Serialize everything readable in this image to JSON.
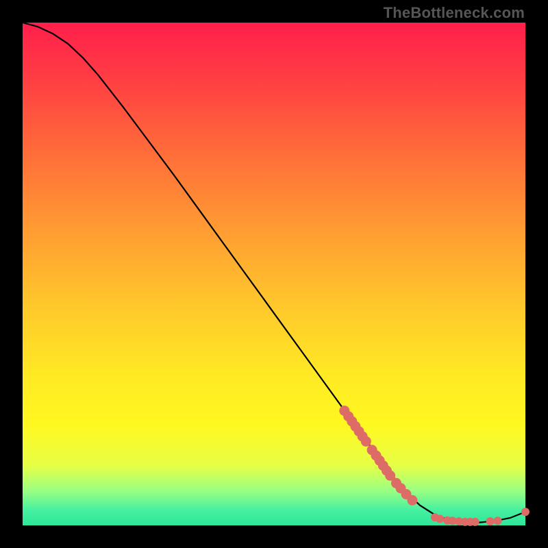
{
  "watermark": "TheBottleneck.com",
  "chart_data": {
    "type": "line",
    "title": "",
    "xlabel": "",
    "ylabel": "",
    "xlim": [
      0,
      100
    ],
    "ylim": [
      0,
      100
    ],
    "grid": false,
    "legend": false,
    "curve": [
      {
        "x": 0,
        "y": 100
      },
      {
        "x": 3,
        "y": 99.2
      },
      {
        "x": 6,
        "y": 97.8
      },
      {
        "x": 9,
        "y": 95.8
      },
      {
        "x": 12,
        "y": 93.0
      },
      {
        "x": 15,
        "y": 89.6
      },
      {
        "x": 20,
        "y": 83.2
      },
      {
        "x": 25,
        "y": 76.5
      },
      {
        "x": 30,
        "y": 69.8
      },
      {
        "x": 35,
        "y": 62.9
      },
      {
        "x": 40,
        "y": 56.0
      },
      {
        "x": 45,
        "y": 49.1
      },
      {
        "x": 50,
        "y": 42.2
      },
      {
        "x": 55,
        "y": 35.3
      },
      {
        "x": 60,
        "y": 28.4
      },
      {
        "x": 65,
        "y": 21.5
      },
      {
        "x": 70,
        "y": 14.6
      },
      {
        "x": 73,
        "y": 10.5
      },
      {
        "x": 76,
        "y": 6.9
      },
      {
        "x": 79,
        "y": 4.0
      },
      {
        "x": 82,
        "y": 2.1
      },
      {
        "x": 85,
        "y": 1.0
      },
      {
        "x": 88,
        "y": 0.6
      },
      {
        "x": 91,
        "y": 0.6
      },
      {
        "x": 94,
        "y": 0.9
      },
      {
        "x": 97,
        "y": 1.5
      },
      {
        "x": 100,
        "y": 2.7
      }
    ],
    "markers_upper": [
      {
        "x": 64.0,
        "y": 22.8
      },
      {
        "x": 64.8,
        "y": 21.7
      },
      {
        "x": 65.5,
        "y": 20.7
      },
      {
        "x": 66.2,
        "y": 19.7
      },
      {
        "x": 66.9,
        "y": 18.7
      },
      {
        "x": 67.6,
        "y": 17.7
      },
      {
        "x": 68.3,
        "y": 16.7
      },
      {
        "x": 69.5,
        "y": 15.0
      },
      {
        "x": 70.3,
        "y": 13.9
      },
      {
        "x": 71.0,
        "y": 12.9
      },
      {
        "x": 71.7,
        "y": 11.9
      },
      {
        "x": 72.4,
        "y": 10.9
      },
      {
        "x": 73.1,
        "y": 9.9
      },
      {
        "x": 74.3,
        "y": 8.4
      },
      {
        "x": 75.2,
        "y": 7.4
      },
      {
        "x": 76.3,
        "y": 6.2
      },
      {
        "x": 77.5,
        "y": 5.0
      }
    ],
    "markers_lower": [
      {
        "x": 82.0,
        "y": 1.6
      },
      {
        "x": 83.0,
        "y": 1.3
      },
      {
        "x": 84.5,
        "y": 1.0
      },
      {
        "x": 85.5,
        "y": 0.9
      },
      {
        "x": 86.8,
        "y": 0.8
      },
      {
        "x": 88.0,
        "y": 0.7
      },
      {
        "x": 89.0,
        "y": 0.7
      },
      {
        "x": 90.0,
        "y": 0.7
      },
      {
        "x": 93.0,
        "y": 0.8
      },
      {
        "x": 94.5,
        "y": 0.9
      },
      {
        "x": 100.0,
        "y": 2.7
      }
    ],
    "marker_radius_upper": 7.5,
    "marker_radius_lower": 6.0,
    "colors": {
      "curve": "#000000",
      "markers": "#dd6b66",
      "gradient_top": "#ff1f4b",
      "gradient_mid": "#ffe924",
      "gradient_bottom": "#2ee69a",
      "background": "#000000"
    }
  }
}
